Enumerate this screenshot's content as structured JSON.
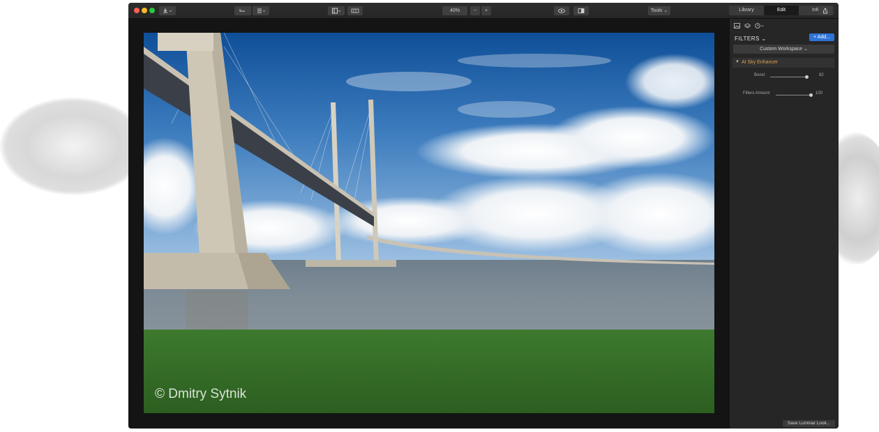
{
  "toolbar": {
    "zoom_value": "40%",
    "zoom_minus": "−",
    "zoom_plus": "+",
    "tools_label": "Tools ⌄"
  },
  "tabs": [
    {
      "label": "Library",
      "active": false
    },
    {
      "label": "Edit",
      "active": true
    },
    {
      "label": "Info",
      "active": false
    }
  ],
  "photo": {
    "watermark": "© Dmitry Sytnik"
  },
  "panel": {
    "filters_title": "FILTERS ⌄",
    "add_button": "+ Add...",
    "workspace_label": "Custom Workspace ⌄",
    "filter": {
      "name": "AI Sky Enhancer",
      "arrow": "▼",
      "boost_label": "Boost",
      "boost_value": "82"
    },
    "filters_amount_label": "Filters Amount",
    "filters_amount_value": "100",
    "save_look_button": "Save Luminar Look..."
  },
  "colors": {
    "accent": "#2f74d8",
    "filter_name": "#e0a34a",
    "panel_bg": "#262626",
    "canvas_bg": "#141414"
  }
}
